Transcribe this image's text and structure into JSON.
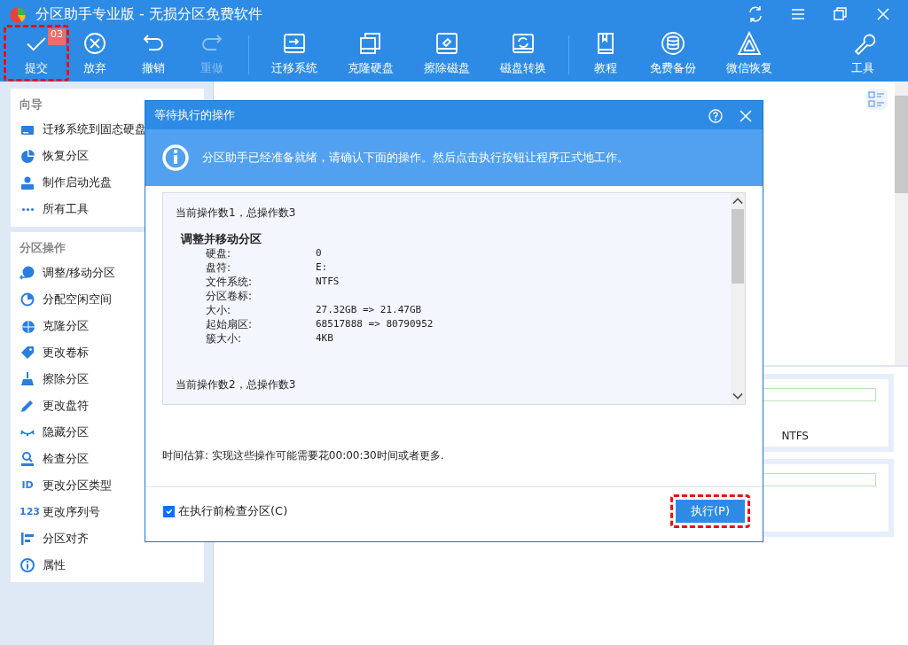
{
  "window": {
    "title": "分区助手专业版 - 无损分区免费软件"
  },
  "toolbar": [
    {
      "label": "提交",
      "disabled": false,
      "badge": "03",
      "highlighted": true
    },
    {
      "label": "放弃",
      "disabled": false,
      "highlighted": false
    },
    {
      "label": "撤销",
      "disabled": false,
      "highlighted": false
    },
    {
      "label": "重做",
      "disabled": true,
      "highlighted": false
    },
    {
      "label": "迁移系统",
      "disabled": false,
      "highlighted": false
    },
    {
      "label": "克隆硬盘",
      "disabled": false,
      "highlighted": false
    },
    {
      "label": "擦除磁盘",
      "disabled": false,
      "highlighted": false
    },
    {
      "label": "磁盘转换",
      "disabled": false,
      "highlighted": false
    },
    {
      "label": "教程",
      "disabled": false,
      "highlighted": false
    },
    {
      "label": "免费备份",
      "disabled": false,
      "highlighted": false
    },
    {
      "label": "微信恢复",
      "disabled": false,
      "highlighted": false
    },
    {
      "label": "工具",
      "disabled": false,
      "highlighted": false
    }
  ],
  "sidebar": {
    "sections": [
      {
        "title": "向导",
        "items": [
          {
            "label": "迁移系统到固态硬盘"
          },
          {
            "label": "恢复分区"
          },
          {
            "label": "制作启动光盘"
          },
          {
            "label": "所有工具"
          }
        ]
      },
      {
        "title": "分区操作",
        "items": [
          {
            "label": "调整/移动分区"
          },
          {
            "label": "分配空闲空间"
          },
          {
            "label": "克隆分区"
          },
          {
            "label": "更改卷标"
          },
          {
            "label": "擦除分区"
          },
          {
            "label": "更改盘符"
          },
          {
            "label": "隐藏分区"
          },
          {
            "label": "检查分区"
          },
          {
            "label": "更改分区类型",
            "icon_text": "ID"
          },
          {
            "label": "更改序列号",
            "icon_text": "123"
          },
          {
            "label": "分区对齐"
          },
          {
            "label": "属性"
          }
        ]
      }
    ]
  },
  "main": {
    "partition_cards": [
      {
        "file_system": "NTFS"
      }
    ]
  },
  "dialog": {
    "title": "等待执行的操作",
    "info": "分区助手已经准备就绪，请确认下面的操作。然后点击执行按钮让程序正式地工作。",
    "operations_log": [
      {
        "kind": "summary",
        "text": "当前操作数1，总操作数3"
      },
      {
        "kind": "heading",
        "text": "调整并移动分区"
      },
      {
        "kind": "field",
        "label": "硬盘:",
        "value": "0"
      },
      {
        "kind": "field",
        "label": "盘符:",
        "value": "E:"
      },
      {
        "kind": "field",
        "label": "文件系统:",
        "value": "NTFS"
      },
      {
        "kind": "field",
        "label": "分区卷标:"
      },
      {
        "kind": "field",
        "label": "大小:",
        "value": "27.32GB => 21.47GB"
      },
      {
        "kind": "field",
        "label": "起始扇区:",
        "value": "68517888 => 80790952"
      },
      {
        "kind": "field",
        "label": "簇大小:",
        "value": "4KB"
      },
      {
        "kind": "summary",
        "text": "当前操作数2，总操作数3"
      }
    ],
    "estimate": "时间估算: 实现这些操作可能需要花00:00:30时间或者更多.",
    "check_before": {
      "label": "在执行前检查分区(C)",
      "checked": true
    },
    "execute_button": {
      "label": "执行(P)",
      "highlighted": true
    }
  }
}
